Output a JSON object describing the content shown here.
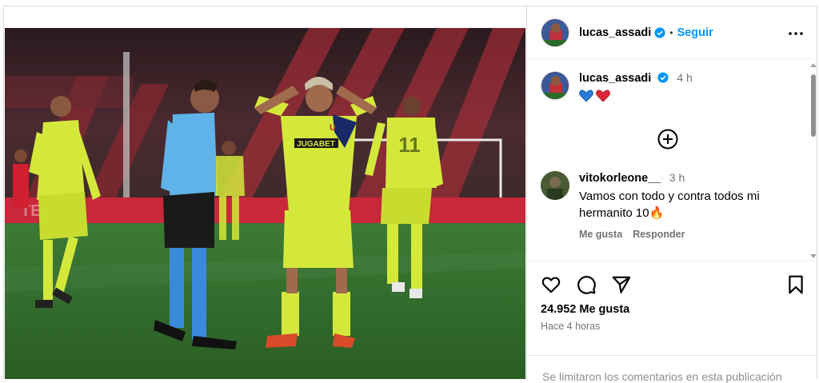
{
  "post": {
    "username": "lucas_assadi",
    "follow_label": "Seguir",
    "separator": "•",
    "likes": "24.952 Me gusta",
    "time_ago": "Hace 4 horas",
    "limited_notice": "Se limitaron los comentarios en esta publicación"
  },
  "caption": {
    "username": "lucas_assadi",
    "time": "4 h",
    "emojis": [
      "blue-heart",
      "red-heart"
    ]
  },
  "comments": [
    {
      "username": "vitokorleone__",
      "time": "3 h",
      "text": "Vamos con todo y contra todos mi hermanito 10🔥",
      "like_label": "Me gusta",
      "reply_label": "Responder"
    }
  ],
  "photo": {
    "jersey_sponsor": "JUGABET",
    "badge_letter": "U"
  },
  "colors": {
    "accent": "#0095f6",
    "verified": "#0095f6",
    "jersey": "#d4e83c",
    "referee": "#5fb3e8",
    "pitch": "#2f6b2a"
  }
}
